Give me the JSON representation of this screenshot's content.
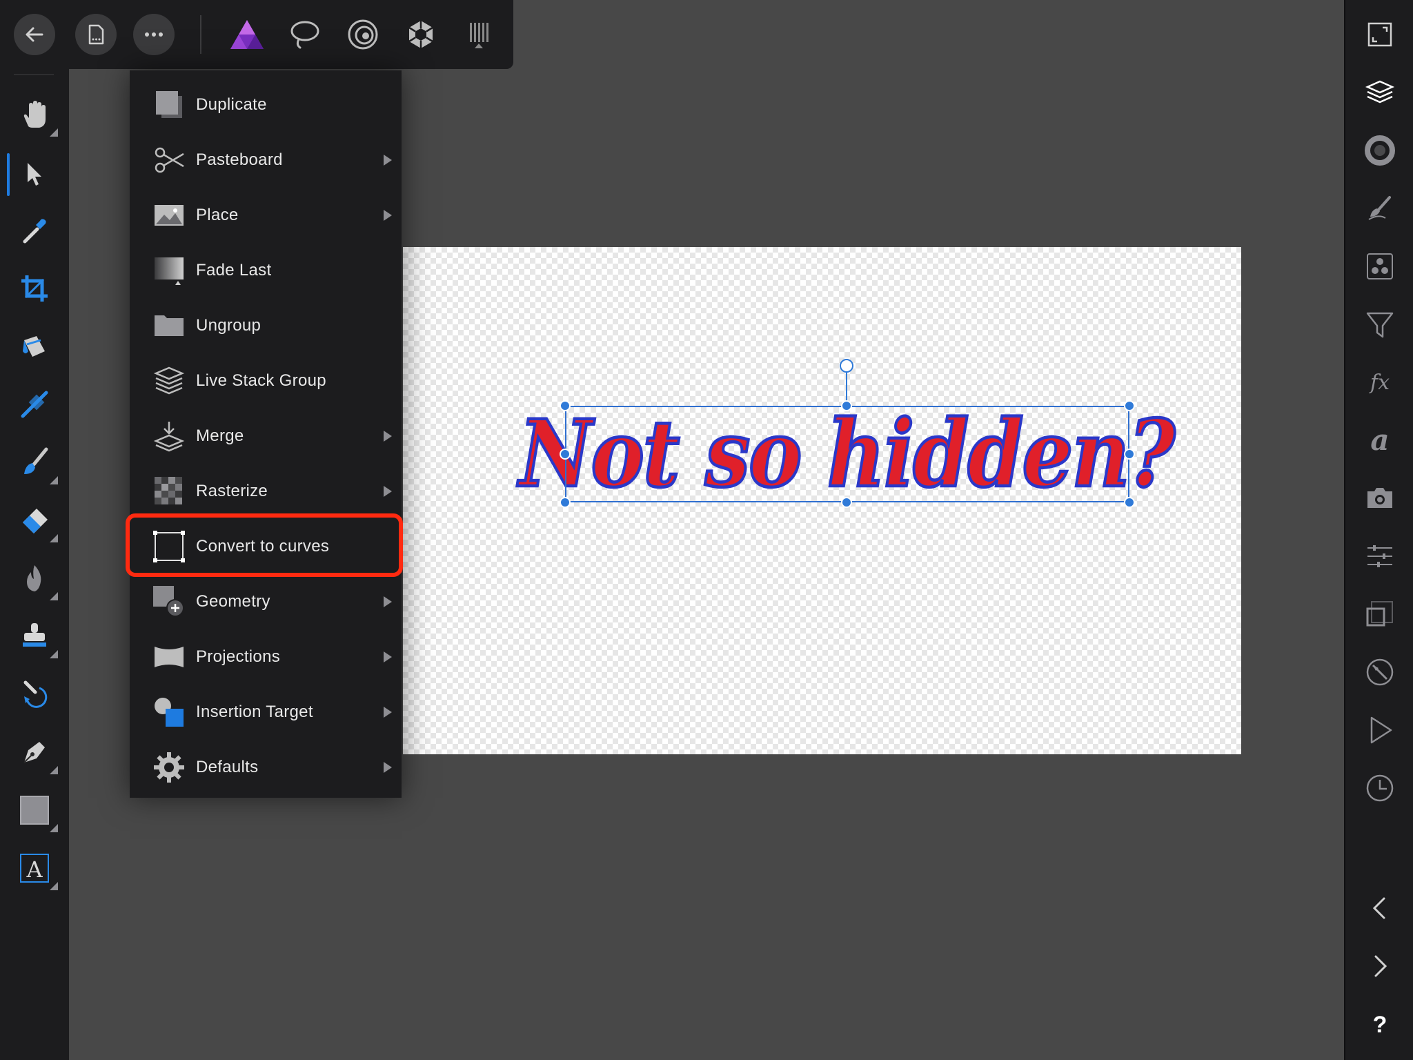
{
  "top_toolbar": {
    "buttons": [
      {
        "name": "back-button",
        "icon": "arrow-left-icon"
      },
      {
        "name": "document-button",
        "icon": "document-icon"
      },
      {
        "name": "more-button",
        "icon": "ellipsis-icon"
      }
    ],
    "personas": [
      {
        "name": "photo-persona",
        "icon": "affinity-photo-icon",
        "active": true
      },
      {
        "name": "liquify-persona",
        "icon": "lasso-icon"
      },
      {
        "name": "develop-persona",
        "icon": "develop-icon"
      },
      {
        "name": "tone-map-persona",
        "icon": "aperture-icon"
      },
      {
        "name": "export-persona",
        "icon": "export-icon"
      }
    ]
  },
  "left_tools": [
    "hand-icon",
    "move-icon",
    "color-picker-icon",
    "crop-icon",
    "flood-fill-icon",
    "gradient-icon",
    "paint-brush-icon",
    "erase-brush-icon",
    "burn-brush-icon",
    "clone-brush-icon",
    "undo-brush-icon",
    "pen-icon",
    "rectangle-icon",
    "artistic-text-icon"
  ],
  "right_studios": [
    "fullscreen-icon",
    "layers-icon",
    "color-icon",
    "brush-icon",
    "adjustments-icon",
    "filter-icon",
    "fx-icon",
    "character-icon",
    "stock-camera-icon",
    "transform-sliders-icon",
    "navigator-icon",
    "compass-icon",
    "macro-play-icon",
    "history-icon",
    "previous-icon",
    "next-icon",
    "help-icon"
  ],
  "context_menu": {
    "items": [
      {
        "label": "Duplicate",
        "icon": "duplicate-icon",
        "has_submenu": false
      },
      {
        "label": "Pasteboard",
        "icon": "scissors-icon",
        "has_submenu": true
      },
      {
        "label": "Place",
        "icon": "place-image-icon",
        "has_submenu": true
      },
      {
        "label": "Fade Last",
        "icon": "fade-icon",
        "has_submenu": false
      },
      {
        "label": "Ungroup",
        "icon": "folder-icon",
        "has_submenu": false
      },
      {
        "label": "Live Stack Group",
        "icon": "stack-icon",
        "has_submenu": false
      },
      {
        "label": "Merge",
        "icon": "merge-icon",
        "has_submenu": true
      },
      {
        "label": "Rasterize",
        "icon": "rasterize-icon",
        "has_submenu": true
      },
      {
        "label": "Convert to curves",
        "icon": "curves-icon",
        "has_submenu": false,
        "highlighted": true
      },
      {
        "label": "Geometry",
        "icon": "geometry-add-icon",
        "has_submenu": true
      },
      {
        "label": "Projections",
        "icon": "projection-icon",
        "has_submenu": true
      },
      {
        "label": "Insertion Target",
        "icon": "insertion-target-icon",
        "has_submenu": true
      },
      {
        "label": "Defaults",
        "icon": "gear-icon",
        "has_submenu": true
      }
    ]
  },
  "canvas": {
    "text": "Not so hidden?"
  },
  "colors": {
    "accent": "#1e7be0",
    "highlight_ring": "#ff2a10",
    "text_fill": "#e0202a",
    "text_stroke": "#2a38c9"
  }
}
